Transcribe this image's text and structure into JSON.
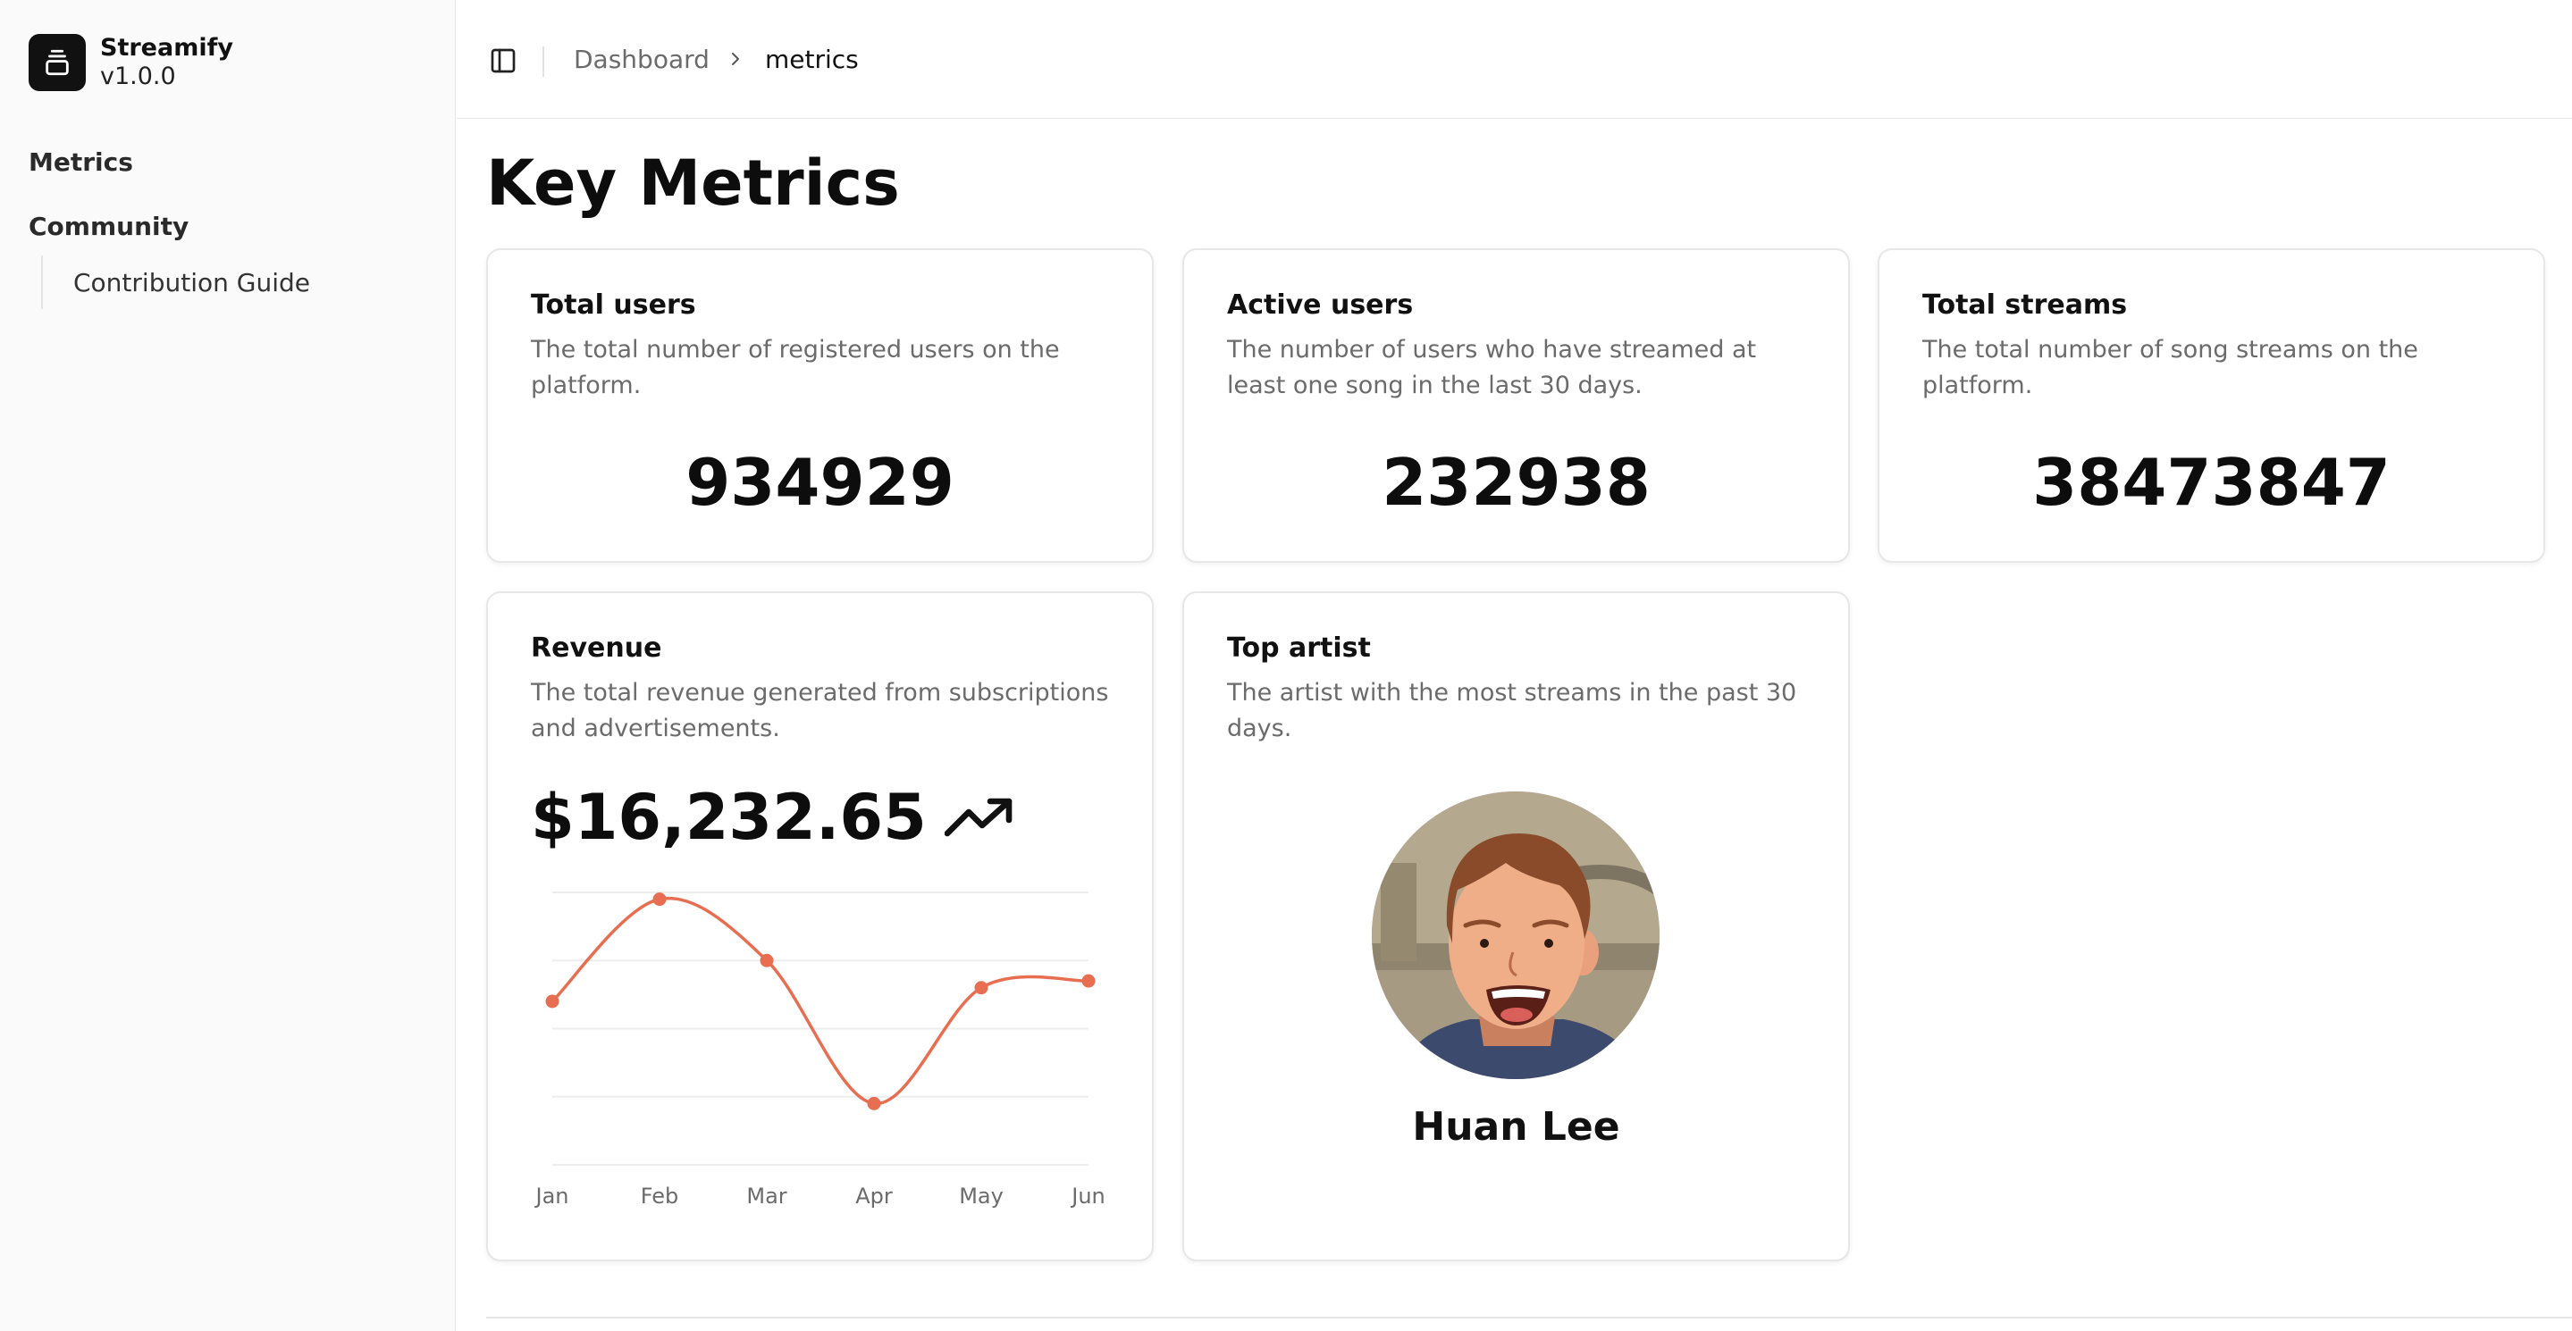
{
  "app": {
    "name": "Streamify",
    "version": "v1.0.0"
  },
  "sidebar": {
    "items": [
      {
        "label": "Metrics"
      },
      {
        "label": "Community"
      }
    ],
    "subitems": [
      {
        "label": "Contribution Guide"
      }
    ]
  },
  "header": {
    "breadcrumb": [
      "Dashboard",
      "metrics"
    ]
  },
  "page": {
    "title": "Key Metrics"
  },
  "cards": {
    "total_users": {
      "title": "Total users",
      "description": "The total number of registered users on the platform.",
      "value": "934929"
    },
    "active_users": {
      "title": "Active users",
      "description": "The number of users who have streamed at least one song in the last 30 days.",
      "value": "232938"
    },
    "total_streams": {
      "title": "Total streams",
      "description": "The total number of song streams on the platform.",
      "value": "38473847"
    },
    "revenue": {
      "title": "Revenue",
      "description": "The total revenue generated from subscriptions and advertisements.",
      "value": "$16,232.65",
      "trend_icon": "trending-up-icon"
    },
    "top_artist": {
      "title": "Top artist",
      "description": "The artist with the most streams in the past 30 days.",
      "name": "Huan Lee"
    }
  },
  "chart_data": {
    "type": "line",
    "categories": [
      "Jan",
      "Feb",
      "Mar",
      "Apr",
      "May",
      "Jun"
    ],
    "series": [
      {
        "values": [
          2.4,
          3.9,
          3.0,
          0.9,
          2.6,
          2.7
        ]
      }
    ],
    "ylim": [
      0,
      4
    ],
    "grid": true,
    "color": "#e76e50"
  },
  "colors": {
    "accent_line": "#e76e50",
    "sidebar_bg": "#fafafa",
    "logo_bg": "#111111"
  }
}
